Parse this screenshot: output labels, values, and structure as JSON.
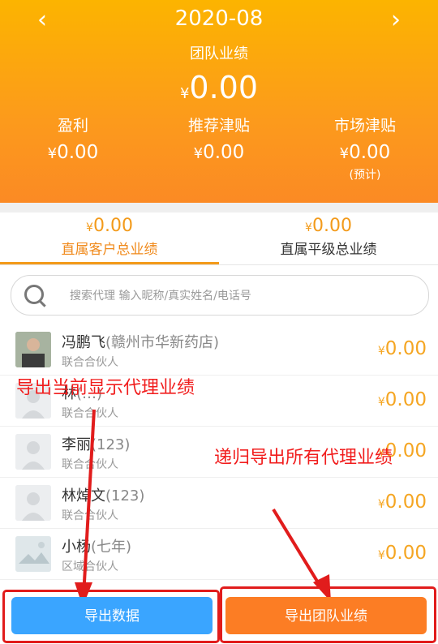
{
  "header": {
    "month": "2020-08",
    "team_label": "团队业绩",
    "team_value": "0.00",
    "yen": "¥",
    "stats": [
      {
        "label": "盈利",
        "value": "0.00",
        "note": ""
      },
      {
        "label": "推荐津贴",
        "value": "0.00",
        "note": ""
      },
      {
        "label": "市场津贴",
        "value": "0.00",
        "note": "(预计)"
      }
    ]
  },
  "tabs": [
    {
      "value": "0.00",
      "label": "直属客户总业绩",
      "active": true
    },
    {
      "value": "0.00",
      "label": "直属平级总业绩",
      "active": false
    }
  ],
  "search": {
    "placeholder": "搜索代理 输入昵称/真实姓名/电话号"
  },
  "agents": [
    {
      "name": "冯鹏飞",
      "paren": "(赣州市华新药店)",
      "role": "联合合伙人",
      "amount": "0.00"
    },
    {
      "name": "林",
      "paren": "(…)",
      "role": "联合合伙人",
      "amount": "0.00"
    },
    {
      "name": "李丽",
      "paren": "(123)",
      "role": "联合合伙人",
      "amount": "0.00"
    },
    {
      "name": "林焯文",
      "paren": "(123)",
      "role": "联合合伙人",
      "amount": "0.00"
    },
    {
      "name": "小杨",
      "paren": "(七年)",
      "role": "区域合伙人",
      "amount": "0.00"
    }
  ],
  "annotations": {
    "left": "导出当前显示代理业绩",
    "right": "递归导出所有代理业绩"
  },
  "buttons": {
    "export_data": "导出数据",
    "export_team": "导出团队业绩"
  }
}
